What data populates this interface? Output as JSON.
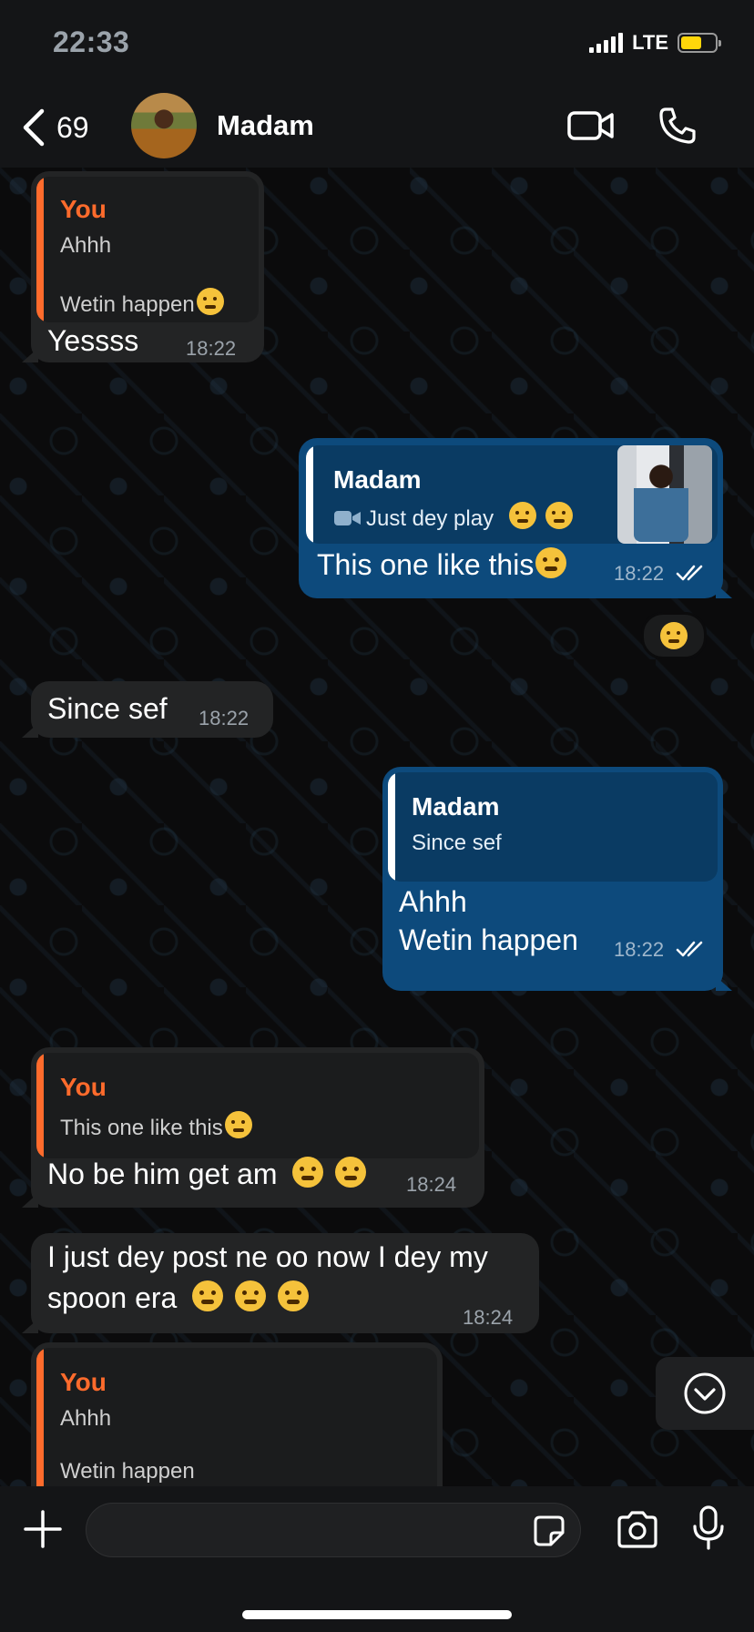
{
  "status": {
    "time": "22:33",
    "network": "LTE",
    "battery_level": 0.6
  },
  "header": {
    "back_count": "69",
    "contact_name": "Madam"
  },
  "messages": [
    {
      "dir": "in",
      "quote_author": "You",
      "quote_lines": [
        "Ahhh",
        "",
        "Wetin happen"
      ],
      "quote_emoji": "crying-face",
      "text": "Yessss",
      "time": "18:22"
    },
    {
      "dir": "out",
      "quote_author": "Madam",
      "quote_text": "Just dey play",
      "quote_emojis": [
        "unamused-face",
        "unamused-face"
      ],
      "text": "This one like this",
      "text_emoji": "face-with-diagonal-mouth",
      "time": "18:22",
      "status": "read",
      "reaction": "tears-of-joy"
    },
    {
      "dir": "in",
      "text": "Since sef",
      "time": "18:22"
    },
    {
      "dir": "out",
      "quote_author": "Madam",
      "quote_text": "Since sef",
      "text_lines": [
        "Ahhh",
        "",
        "Wetin happen"
      ],
      "time": "18:22",
      "status": "read"
    },
    {
      "dir": "in",
      "quote_author": "You",
      "quote_text": "This one like this",
      "quote_emoji": "face-with-diagonal-mouth",
      "text": "No be him get am",
      "text_emojis": [
        "tears-of-joy",
        "tears-of-joy"
      ],
      "time": "18:24"
    },
    {
      "dir": "in",
      "text_lines": [
        "I just dey post ne oo now I dey my",
        "spoon era"
      ],
      "text_emojis": [
        "face-with-hand-over-mouth",
        "tears-of-joy",
        "tears-of-joy"
      ],
      "time": "18:24"
    },
    {
      "dir": "in",
      "quote_author": "You",
      "quote_lines": [
        "Ahhh",
        "",
        "Wetin happen"
      ]
    }
  ],
  "colors": {
    "accent_you": "#ff6b2c",
    "outgoing_bubble": "#0d4a7c",
    "incoming_bubble": "#232425",
    "background": "#0b0b0c"
  },
  "composer": {
    "placeholder": ""
  },
  "icons": [
    "chevron-left-icon",
    "video-camera-icon",
    "phone-icon",
    "plus-icon",
    "sticker-icon",
    "camera-icon",
    "microphone-icon",
    "scroll-down-icon",
    "double-check-icon",
    "video-icon"
  ]
}
